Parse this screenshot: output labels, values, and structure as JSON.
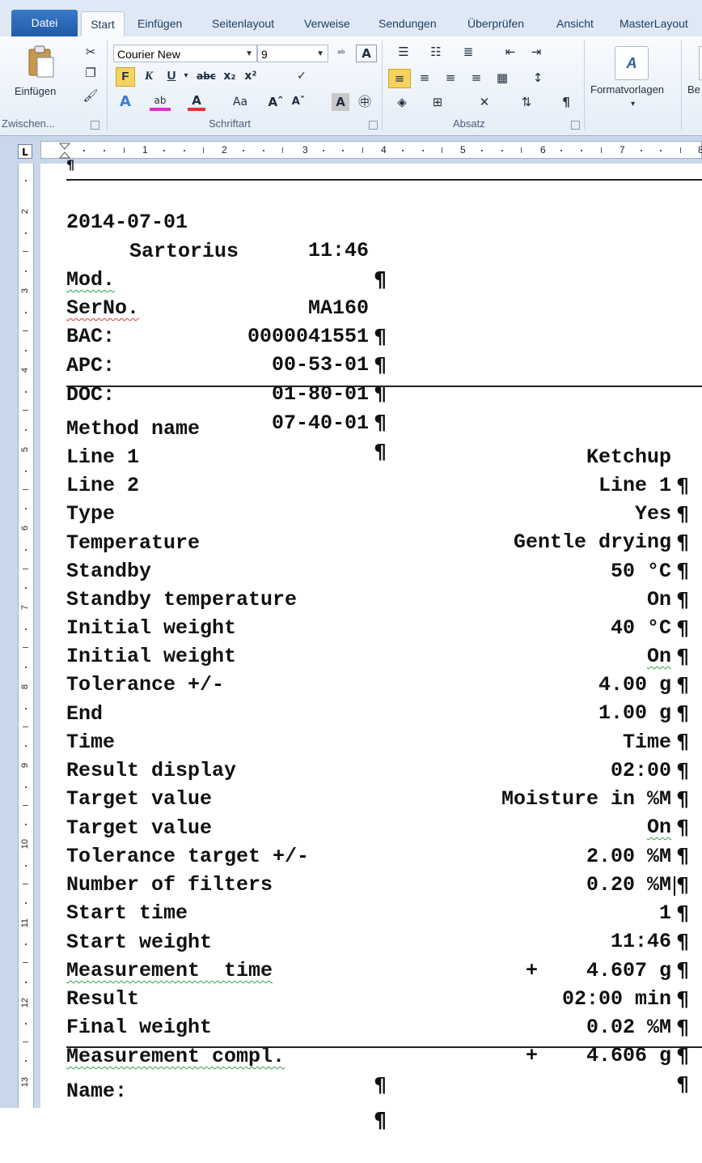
{
  "tabs": [
    "Datei",
    "Start",
    "Einfügen",
    "Seitenlayout",
    "Verweise",
    "Sendungen",
    "Überprüfen",
    "Ansicht",
    "MasterLayout"
  ],
  "ribbon": {
    "paste_label": "Einfügen",
    "clipboard_group": "Zwischen...",
    "font_name": "Courier New",
    "font_size": "9",
    "font_group": "Schriftart",
    "paragraph_group": "Absatz",
    "styles_label": "Formatvorlagen",
    "edit_label_partial": "Be",
    "bold": "F",
    "italic": "K",
    "underline": "U",
    "strike": "abc",
    "case": "Aa",
    "pilcrow": "¶"
  },
  "ruler": {
    "corner": "L",
    "h_numbers": [
      "1",
      "2",
      "3",
      "4",
      "5",
      "6",
      "7",
      "8"
    ],
    "v_numbers": [
      "2",
      "3",
      "4",
      "5",
      "6",
      "7",
      "8",
      "9",
      "10",
      "11",
      "12",
      "13"
    ]
  },
  "doc": {
    "pilcrow": "¶",
    "date": "2014-07-01",
    "time": "11:46",
    "brand": "Sartorius",
    "header_rows": [
      {
        "k": "Mod.",
        "v": "MA160"
      },
      {
        "k": "SerNo.",
        "v": "0000041551"
      },
      {
        "k": "BAC:",
        "v": "00-53-01"
      },
      {
        "k": "APC:",
        "v": "01-80-01"
      },
      {
        "k": "DOC:",
        "v": "07-40-01"
      }
    ],
    "rows": [
      {
        "k": "Method name",
        "v": "Ketchup"
      },
      {
        "k": "Line 1",
        "v": "Line 1"
      },
      {
        "k": "Line 2",
        "v": "Yes"
      },
      {
        "k": "Type",
        "v": "Gentle drying"
      },
      {
        "k": "Temperature",
        "v": "50 °C"
      },
      {
        "k": "Standby",
        "v": "On"
      },
      {
        "k": "Standby temperature",
        "v": "40 °C"
      },
      {
        "k": "Initial weight",
        "v": "On"
      },
      {
        "k": "Initial weight",
        "v": "4.00 g"
      },
      {
        "k": "Tolerance +/-",
        "v": "1.00 g"
      },
      {
        "k": "End",
        "v": "Time"
      },
      {
        "k": "Time",
        "v": "02:00"
      },
      {
        "k": "Result display",
        "v": "Moisture in %M"
      },
      {
        "k": "Target value",
        "v": "On"
      },
      {
        "k": "Target value",
        "v": "2.00 %M"
      },
      {
        "k": "Tolerance target +/-",
        "v": "0.20 %M"
      },
      {
        "k": "Number of filters",
        "v": "1"
      },
      {
        "k": "Start time",
        "v": "11:46"
      },
      {
        "k": "Start weight",
        "v": "+    4.607 g"
      },
      {
        "k": "Measurement  time",
        "v": "02:00 min"
      },
      {
        "k": "Result",
        "v": "0.02 %M"
      },
      {
        "k": "Final weight",
        "v": "+    4.606 g"
      }
    ],
    "measurement_compl": "Measurement compl.",
    "name_label": "Name:"
  }
}
